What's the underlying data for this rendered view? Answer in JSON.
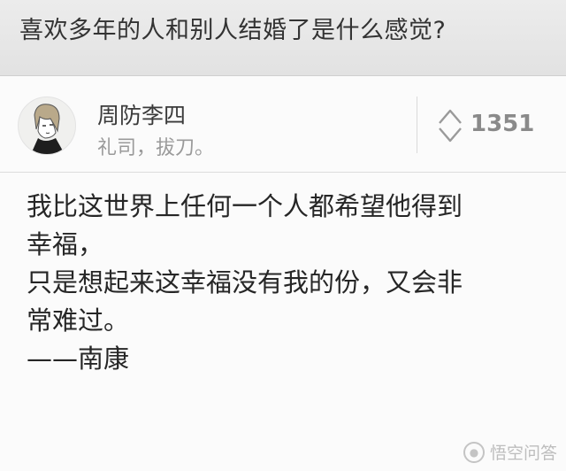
{
  "header": {
    "title": "喜欢多年的人和别人结婚了是什么感觉?"
  },
  "answer": {
    "author_name": "周防李四",
    "author_bio": "礼司，拔刀。",
    "vote_count": "1351",
    "content_lines": [
      "我比这世界上任何一个人都希望他得到",
      "幸福，",
      "只是想起来这幸福没有我的份，又会非",
      "常难过。",
      "——南康"
    ]
  },
  "watermark": {
    "text": "悟空问答"
  },
  "icons": {
    "vote": "vote-updown-icon",
    "avatar": "avatar-illustration"
  }
}
